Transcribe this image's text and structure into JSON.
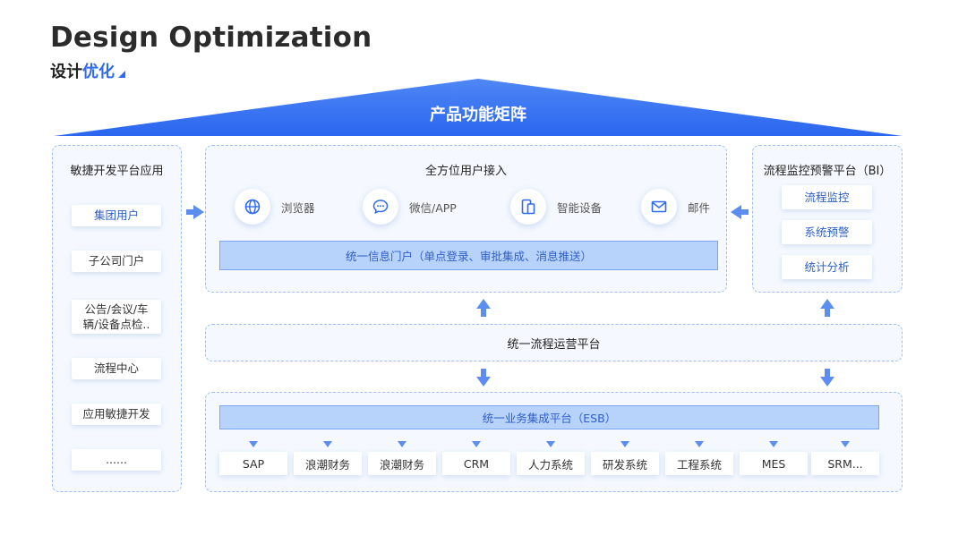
{
  "header": {
    "title": "Design Optimization",
    "subtitle_part1": "设计",
    "subtitle_part2": "优化"
  },
  "roof": {
    "label": "产品功能矩阵",
    "color": "#2f6bf0"
  },
  "left_panel": {
    "title": "敏捷开发平台应用",
    "items": [
      {
        "label": "集团用户"
      },
      {
        "label": "子公司门户"
      },
      {
        "label": "公告/会议/车\n辆/设备点检.."
      },
      {
        "label": "流程中心"
      },
      {
        "label": "应用敏捷开发"
      },
      {
        "label": "......"
      }
    ]
  },
  "center_top": {
    "title": "全方位用户接入",
    "channels": [
      {
        "label": "浏览器",
        "icon": "globe-icon"
      },
      {
        "label": "微信/APP",
        "icon": "chat-icon"
      },
      {
        "label": "智能设备",
        "icon": "device-icon"
      },
      {
        "label": "邮件",
        "icon": "mail-icon"
      }
    ],
    "portal": "统一信息门户（单点登录、审批集成、消息推送）"
  },
  "right_panel": {
    "title": "流程监控预警平台（BI）",
    "items": [
      {
        "label": "流程监控"
      },
      {
        "label": "系统预警"
      },
      {
        "label": "统计分析"
      }
    ]
  },
  "middle": {
    "label": "统一流程运营平台"
  },
  "bottom": {
    "esb": "统一业务集成平台（ESB）",
    "systems": [
      {
        "label": "SAP"
      },
      {
        "label": "浪潮财务"
      },
      {
        "label": "浪潮财务"
      },
      {
        "label": "CRM"
      },
      {
        "label": "人力系统"
      },
      {
        "label": "研发系统"
      },
      {
        "label": "工程系统"
      },
      {
        "label": "MES"
      },
      {
        "label": "SRM..."
      }
    ]
  },
  "colors": {
    "accent": "#2f6bf0",
    "panel_border": "#9dbff5",
    "bar_fill": "#b7d2fb",
    "arrow": "#5b8ef0"
  }
}
